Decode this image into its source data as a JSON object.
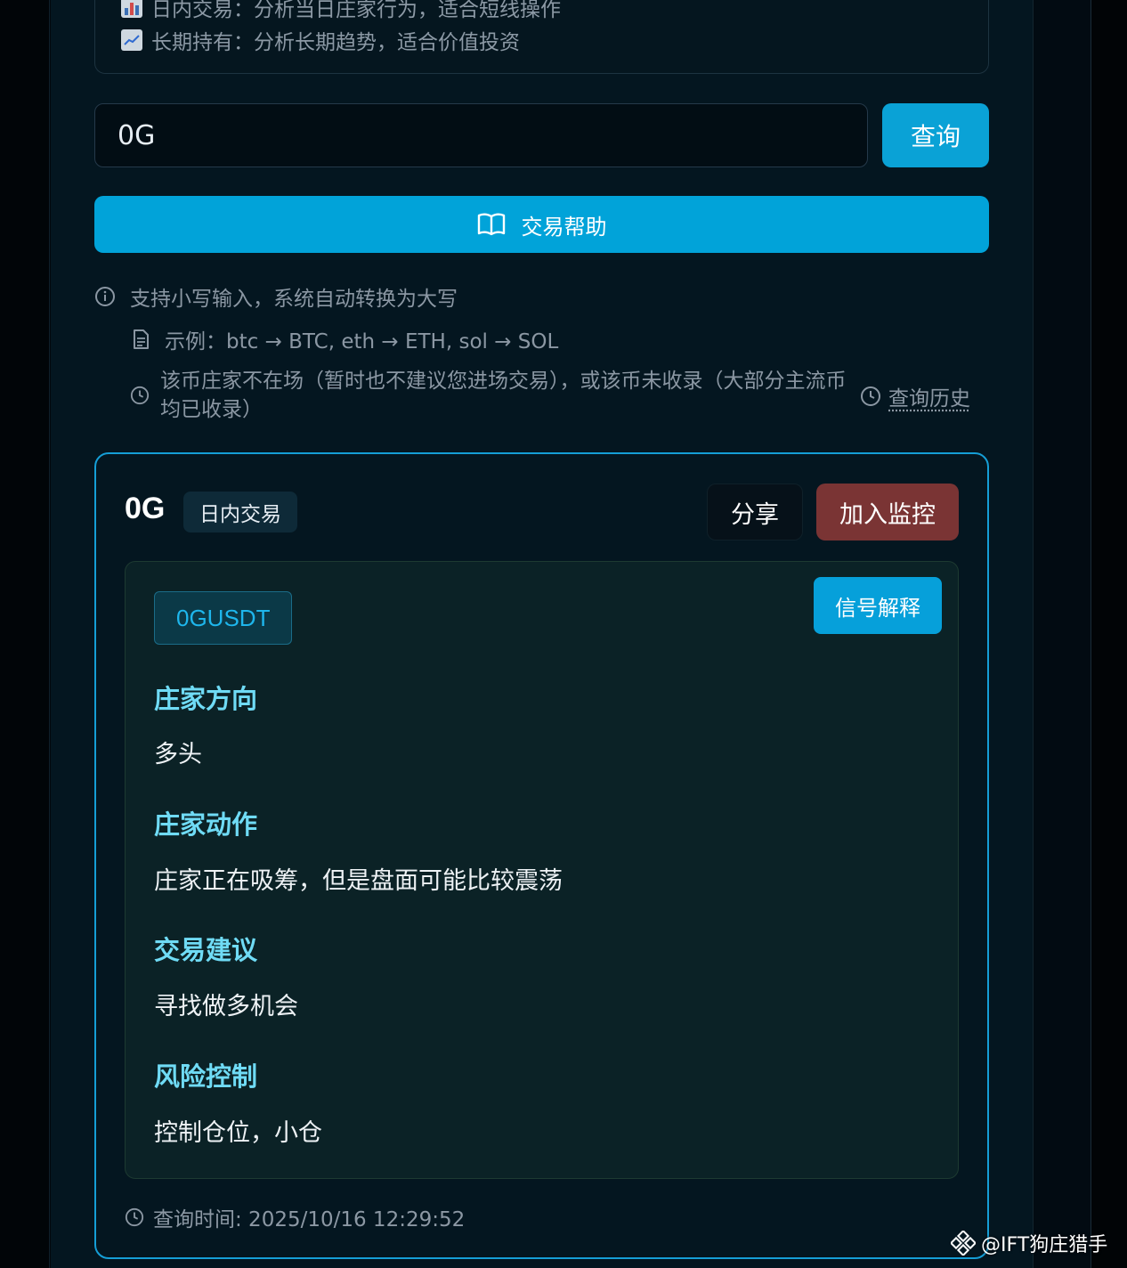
{
  "modes": [
    {
      "icon": "bar-chart-icon",
      "text": "日内交易：分析当日庄家行为，适合短线操作"
    },
    {
      "icon": "trend-chart-icon",
      "text": "长期持有：分析长期趋势，适合价值投资"
    }
  ],
  "search": {
    "value": "0G"
  },
  "query_label": "查询",
  "help_label": "交易帮助",
  "tips": {
    "case": "支持小写输入，系统自动转换为大写",
    "example": "示例：btc → BTC, eth → ETH, sol → SOL",
    "notice": "该币庄家不在场（暂时也不建议您进场交易），或该币未收录（大部分主流币均已收录）"
  },
  "history_label": "查询历史",
  "result": {
    "coin": "0G",
    "mode": "日内交易",
    "share_label": "分享",
    "monitor_label": "加入监控",
    "pair": "0GUSDT",
    "explain_label": "信号解释",
    "sections": [
      {
        "title": "庄家方向",
        "text": "多头"
      },
      {
        "title": "庄家动作",
        "text": "庄家正在吸筹，但是盘面可能比较震荡"
      },
      {
        "title": "交易建议",
        "text": "寻找做多机会"
      },
      {
        "title": "风险控制",
        "text": "控制仓位，小仓"
      }
    ],
    "query_time": "查询时间: 2025/10/16 12:29:52"
  },
  "watermark": "@IFT狗庄猎手",
  "colors": {
    "accent": "#0aa2d6",
    "monitor": "#7a3434",
    "section_title": "#6fdbf5",
    "card_border": "#159ed6"
  }
}
